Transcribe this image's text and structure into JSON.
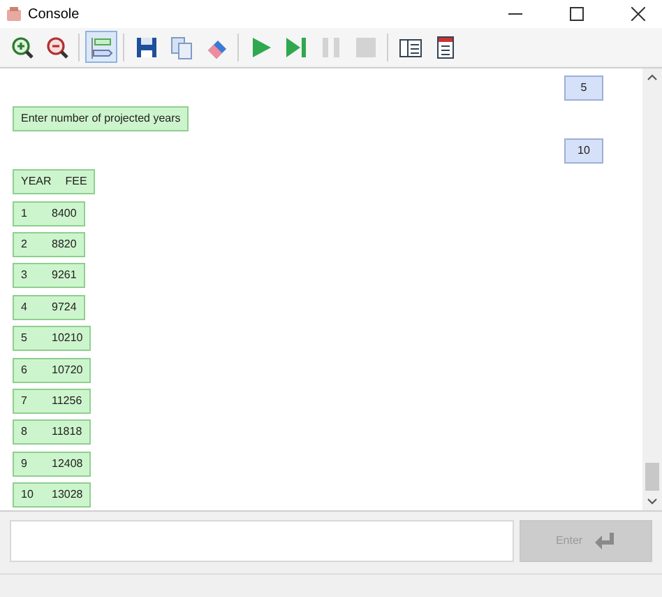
{
  "window": {
    "title": "Console"
  },
  "toolbar": [
    {
      "kind": "zoom-in",
      "pressed": false,
      "disabled": false
    },
    {
      "kind": "zoom-out",
      "pressed": false,
      "disabled": false
    },
    {
      "kind": "separator"
    },
    {
      "kind": "toggle-view",
      "pressed": true,
      "disabled": false
    },
    {
      "kind": "separator"
    },
    {
      "kind": "save",
      "pressed": false,
      "disabled": false
    },
    {
      "kind": "copy",
      "pressed": false,
      "disabled": false
    },
    {
      "kind": "clear",
      "pressed": false,
      "disabled": false
    },
    {
      "kind": "separator"
    },
    {
      "kind": "run",
      "pressed": false,
      "disabled": false
    },
    {
      "kind": "step",
      "pressed": false,
      "disabled": false
    },
    {
      "kind": "pause",
      "pressed": false,
      "disabled": true
    },
    {
      "kind": "stop",
      "pressed": false,
      "disabled": true
    },
    {
      "kind": "separator"
    },
    {
      "kind": "layout",
      "pressed": false,
      "disabled": false
    },
    {
      "kind": "window",
      "pressed": false,
      "disabled": false
    }
  ],
  "messages": [
    {
      "kind": "input",
      "parts": [
        "5"
      ]
    },
    {
      "kind": "output",
      "parts": [
        "Enter number of projected years"
      ]
    },
    {
      "kind": "input",
      "parts": [
        "10"
      ]
    },
    {
      "kind": "output",
      "parts": [
        "YEAR",
        "FEE"
      ]
    },
    {
      "kind": "output",
      "parts": [
        "1",
        "8400"
      ]
    },
    {
      "kind": "output",
      "parts": [
        "2",
        "8820"
      ]
    },
    {
      "kind": "output",
      "parts": [
        "3",
        "9261"
      ]
    },
    {
      "kind": "output",
      "parts": [
        "4",
        "9724"
      ]
    },
    {
      "kind": "output",
      "parts": [
        "5",
        "10210"
      ]
    },
    {
      "kind": "output",
      "parts": [
        "6",
        "10720"
      ]
    },
    {
      "kind": "output",
      "parts": [
        "7",
        "11256"
      ]
    },
    {
      "kind": "output",
      "parts": [
        "8",
        "11818"
      ]
    },
    {
      "kind": "output",
      "parts": [
        "9",
        "12408"
      ]
    },
    {
      "kind": "output",
      "parts": [
        "10",
        "13028"
      ]
    }
  ],
  "input_bar": {
    "enter_button": {
      "label": "Enter",
      "disabled": true
    }
  }
}
